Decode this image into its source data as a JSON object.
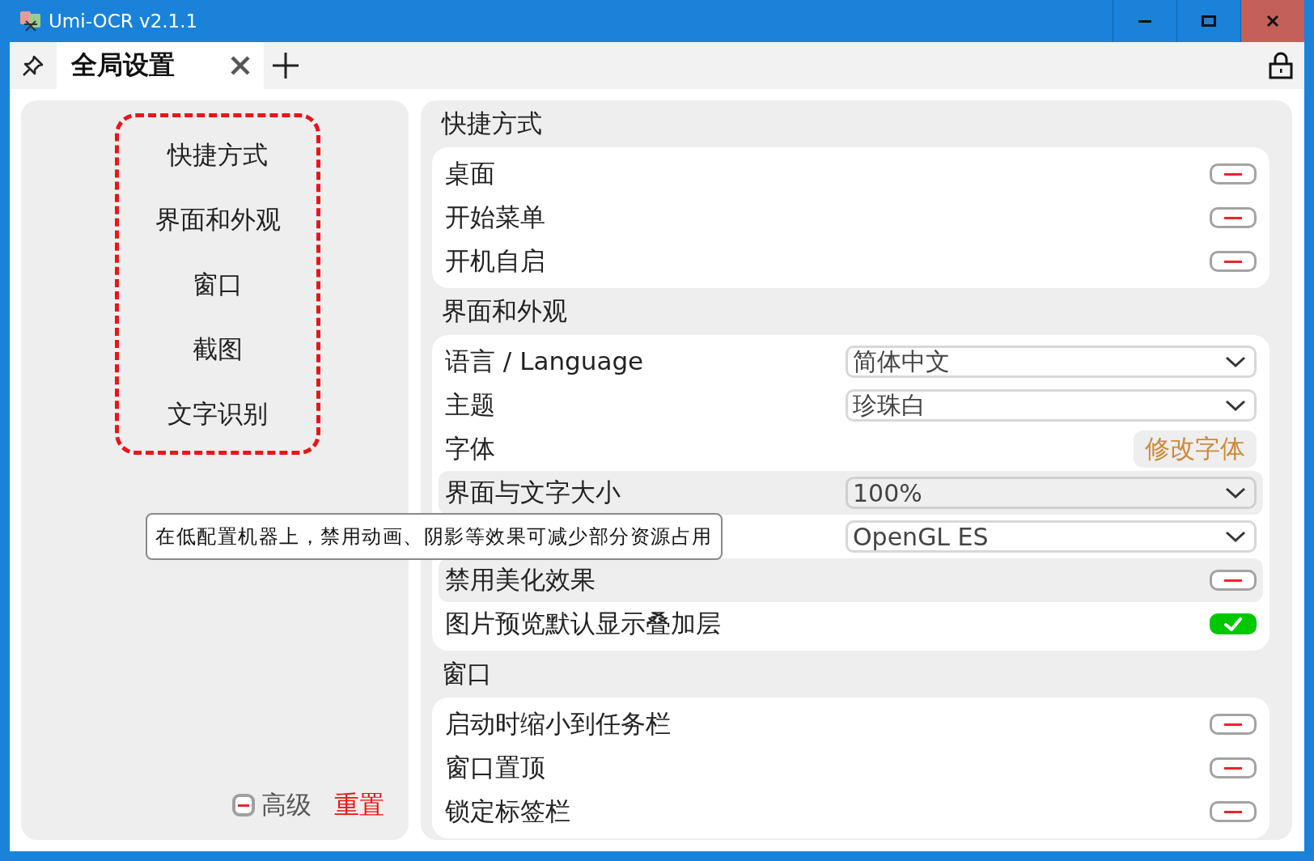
{
  "window": {
    "title": "Umi-OCR v2.1.1"
  },
  "tabs": [
    {
      "label": "全局设置",
      "selected": true
    }
  ],
  "sidebar": {
    "items": [
      {
        "label": "快捷方式"
      },
      {
        "label": "界面和外观"
      },
      {
        "label": "窗口"
      },
      {
        "label": "截图"
      },
      {
        "label": "文字识别"
      }
    ],
    "advanced": {
      "label": "高级",
      "checked": false
    },
    "reset": {
      "label": "重置"
    }
  },
  "sections": [
    {
      "title": "快捷方式",
      "rows": [
        {
          "kind": "switch",
          "label": "桌面",
          "on": false,
          "highlighted": false
        },
        {
          "kind": "switch",
          "label": "开始菜单",
          "on": false,
          "highlighted": false
        },
        {
          "kind": "switch",
          "label": "开机自启",
          "on": false,
          "highlighted": false
        }
      ]
    },
    {
      "title": "界面和外观",
      "rows": [
        {
          "kind": "select",
          "label": "语言 / Language",
          "value": "简体中文",
          "highlighted": false
        },
        {
          "kind": "select",
          "label": "主题",
          "value": "珍珠白",
          "highlighted": false
        },
        {
          "kind": "button",
          "label": "字体",
          "button": "修改字体",
          "highlighted": false
        },
        {
          "kind": "select",
          "label": "界面与文字大小",
          "value": "100%",
          "highlighted": true
        },
        {
          "kind": "select",
          "value": "OpenGL ES",
          "highlighted": false
        },
        {
          "kind": "switch",
          "label": "禁用美化效果",
          "on": false,
          "highlighted": true
        },
        {
          "kind": "switch",
          "label": "图片预览默认显示叠加层",
          "on": true,
          "highlighted": false
        }
      ]
    },
    {
      "title": "窗口",
      "rows": [
        {
          "kind": "switch",
          "label": "启动时缩小到任务栏",
          "on": false,
          "highlighted": false
        },
        {
          "kind": "switch",
          "label": "窗口置顶",
          "on": false,
          "highlighted": false
        },
        {
          "kind": "switch",
          "label": "锁定标签栏",
          "on": false,
          "highlighted": false
        }
      ]
    }
  ],
  "tooltip": {
    "text": "在低配置机器上，禁用动画、阴影等效果可减少部分资源占用"
  }
}
